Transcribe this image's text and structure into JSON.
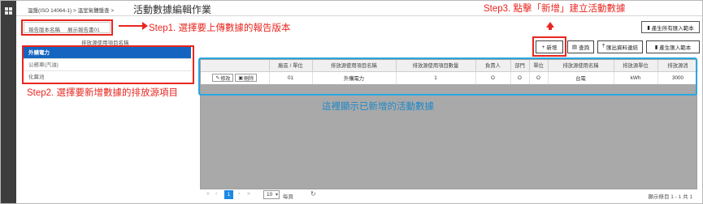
{
  "breadcrumb": "溫盤(ISO 14064-1) > 溫室氣體盤查 >",
  "page_title": "活動數據編輯作業",
  "report": {
    "label": "報告版本名稱",
    "value": "展示報告書01"
  },
  "generate_all_template_label": "產生所有匯入範本",
  "source_list": {
    "title": "排放源使用項目名稱",
    "items": [
      {
        "label": "外購電力",
        "active": true
      },
      {
        "label": "公務車(汽油)",
        "active": false
      },
      {
        "label": "化糞池",
        "active": false
      }
    ]
  },
  "toolbar": {
    "add_label": "新增",
    "query_label": "查詢",
    "export_label": "匯出資料連結",
    "generate_template_label": "產生匯入範本"
  },
  "table": {
    "columns": [
      "",
      "廠區 / 單位",
      "排放源使用項目名稱",
      "排放源使用項目數量",
      "負責人",
      "部門",
      "單位",
      "排放源使用名稱",
      "排放源單位",
      "排放源消"
    ],
    "rows": [
      {
        "edit_label": "修改",
        "delete_label": "刪除",
        "site": "01",
        "item_name": "外購電力",
        "quantity": "1",
        "owner": "O",
        "dept": "O",
        "unit": "O",
        "source_name": "台電",
        "source_unit": "kWh",
        "consumption": "3000"
      }
    ]
  },
  "annotations": {
    "step1": "Step1. 選擇要上傳數據的報告版本",
    "step2": "Step2. 選擇要新增數據的排放源項目",
    "step3": "Step3. 點擊「新增」建立活動數據",
    "note": "這裡顯示已新增的活動數據"
  },
  "pager": {
    "current_page": "1",
    "page_size": "10",
    "per_page_label": "每頁",
    "info": "顯示條目 1 - 1 共 1"
  },
  "colors": {
    "accent_blue": "#1565c0",
    "annotation_red": "#e8261f",
    "annotation_blue": "#29a7e1"
  }
}
